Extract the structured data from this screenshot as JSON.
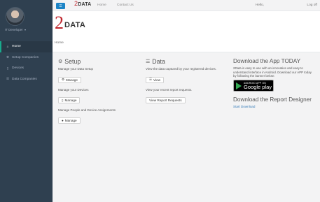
{
  "topbar": {
    "logo": {
      "two": "2",
      "data": "DATA"
    },
    "menu_icon": "hamburger-icon",
    "links": {
      "home": "Home",
      "contact": "Contact Us"
    },
    "hello": "Hello,",
    "logoff": "Log off"
  },
  "sidebar": {
    "user": {
      "name": "IT Developer",
      "caret": "▾"
    },
    "items": [
      {
        "label": "Home",
        "icon": "home-icon",
        "glyph": "⌂",
        "active": true
      },
      {
        "label": "Setup Companies",
        "icon": "gear-icon",
        "glyph": "⚙",
        "active": false
      },
      {
        "label": "Devices",
        "icon": "mobile-icon",
        "glyph": "▯",
        "active": false
      },
      {
        "label": "Data Companies",
        "icon": "database-icon",
        "glyph": "☰",
        "active": false
      }
    ]
  },
  "header": {
    "logo": {
      "two": "2",
      "data": "DATA"
    },
    "breadcrumb": "Home"
  },
  "setup": {
    "title": "Setup",
    "icon": "gears-icon",
    "data_text": "Manage your Data Setup",
    "data_btn": "Manage",
    "devices_text": "Manage your Devices",
    "devices_btn": "Manage",
    "people_text": "Manage People and Device Assignments",
    "people_btn": "Manage"
  },
  "data": {
    "title": "Data",
    "icon": "database-icon",
    "view_text": "View the data captured by your registered devices.",
    "view_btn": "View",
    "reports_text": "View your recent report requests.",
    "reports_btn": "View Report Requests"
  },
  "download": {
    "title": "Download the App TODAY",
    "text": "2Data is easy to use with an innovative and easy to understand interface in Android. Download our APP today by following the banner below:",
    "badge_small": "ANDROID APP ON",
    "badge_big": "Google play",
    "designer_title": "Download the Report Designer",
    "designer_link": "Start Download"
  },
  "colors": {
    "sidebar": "#2f4050",
    "accent": "#1c84c6",
    "logo_red": "#c0262e",
    "active_border": "#19aa8d"
  }
}
